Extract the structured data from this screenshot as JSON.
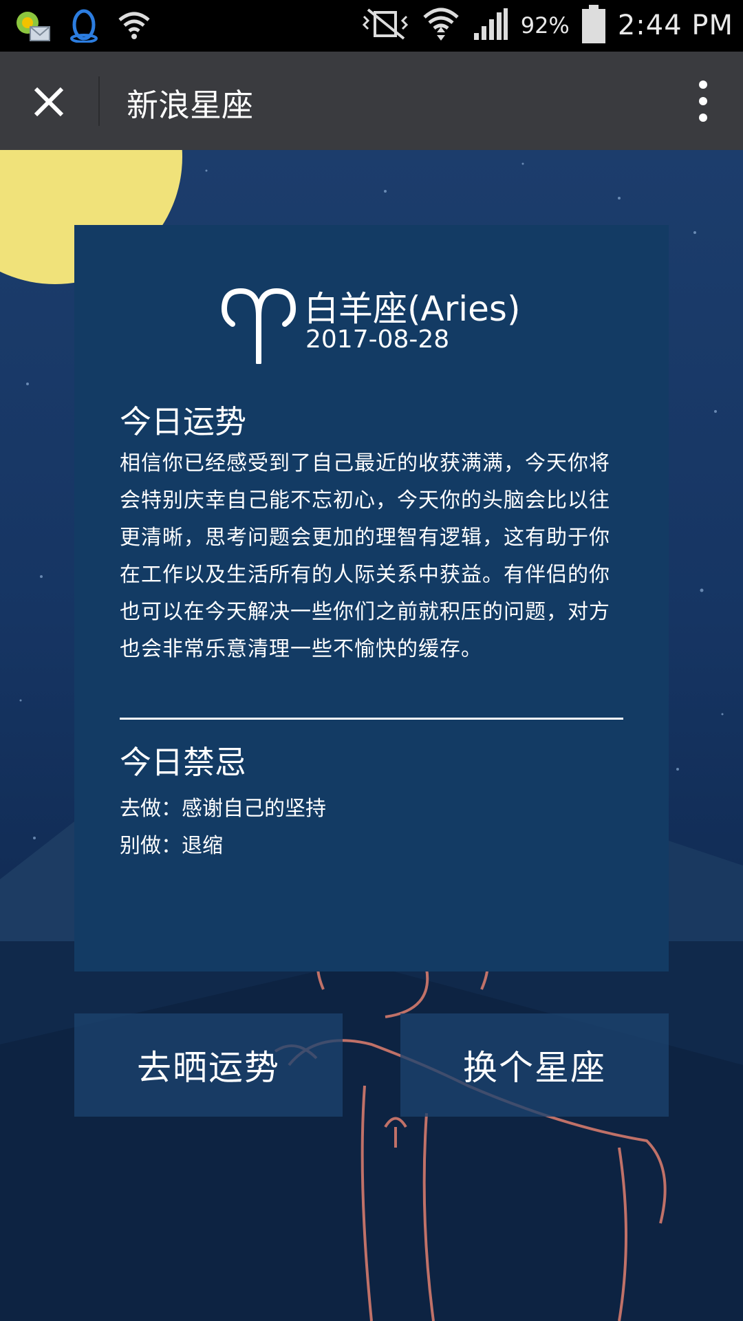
{
  "status_bar": {
    "battery_percent": "92%",
    "time": "2:44 PM",
    "icons": [
      "message-notification-icon",
      "qq-icon",
      "wifi-question-icon",
      "vibrate-silent-icon",
      "wifi-icon",
      "signal-icon",
      "battery-icon"
    ]
  },
  "app_bar": {
    "title": "新浪星座",
    "close_icon": "close-icon",
    "menu_icon": "more-vertical-icon"
  },
  "card": {
    "sign_icon": "aries-icon",
    "sign_name": "白羊座(Aries)",
    "date": "2017-08-28",
    "fortune_title": "今日运势",
    "fortune_text": "相信你已经感受到了自己最近的收获满满，今天你将会特别庆幸自己能不忘初心，今天你的头脑会比以往更清晰，思考问题会更加的理智有逻辑，这有助于你在工作以及生活所有的人际关系中获益。有伴侣的你也可以在今天解决一些你们之前就积压的问题，对方也会非常乐意清理一些不愉快的缓存。",
    "taboo_title": "今日禁忌",
    "taboo_do": "去做：感谢自己的坚持",
    "taboo_dont": "别做：退缩"
  },
  "buttons": {
    "share": "去晒运势",
    "change": "换个星座"
  },
  "colors": {
    "card_bg": "#133b64",
    "moon": "#f0e27a",
    "status_bar": "#000000",
    "app_bar": "#3a3b3f"
  }
}
